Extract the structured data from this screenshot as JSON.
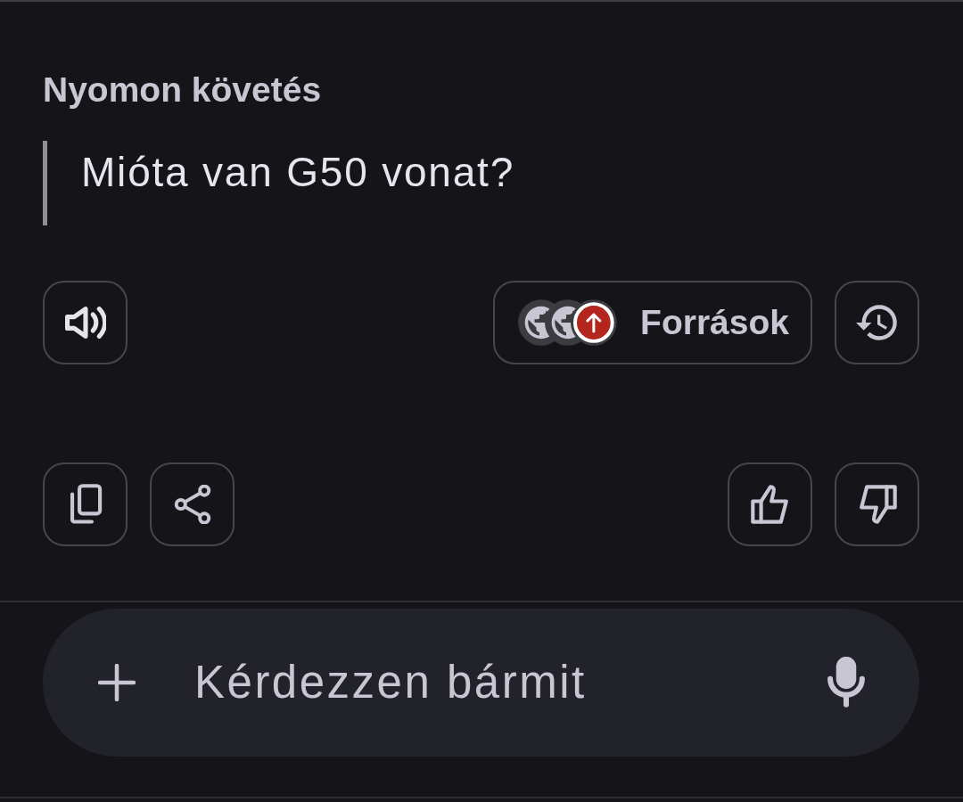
{
  "section": {
    "title": "Nyomon követés"
  },
  "quote": {
    "text": "Mióta van G50 vonat?"
  },
  "sources_button": {
    "label": "Források"
  },
  "input": {
    "placeholder": "Kérdezzen bármit"
  }
}
